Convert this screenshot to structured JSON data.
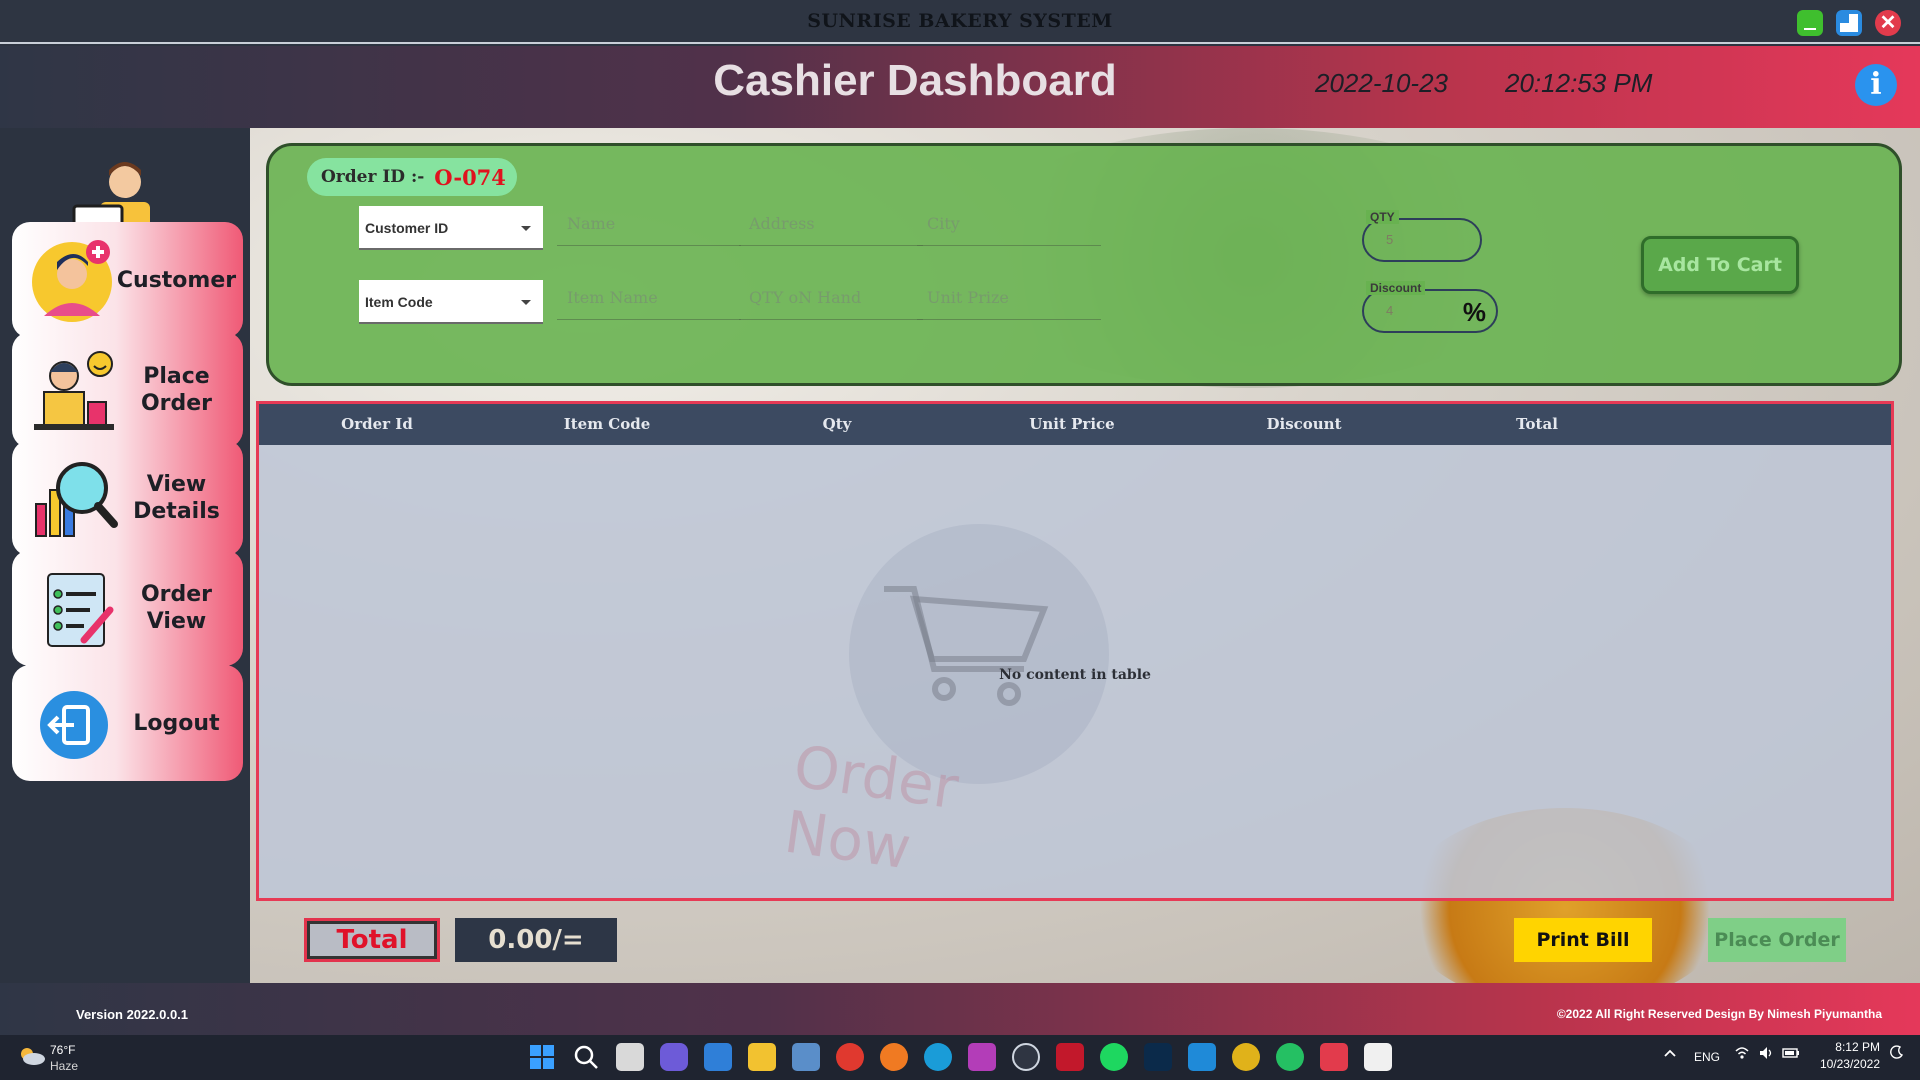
{
  "window": {
    "app_title": "SUNRISE BAKERY SYSTEM",
    "close_glyph": "✕"
  },
  "header": {
    "title": "Cashier Dashboard",
    "date": "2022-10-23",
    "time": "20:12:53 PM",
    "info_glyph": "i"
  },
  "sidebar": {
    "items": [
      {
        "label": "Customer",
        "icon": "customer-icon"
      },
      {
        "label": "Place\nOrder",
        "icon": "place-order-icon"
      },
      {
        "label": "View\nDetails",
        "icon": "view-details-icon"
      },
      {
        "label": "Order\nView",
        "icon": "order-view-icon"
      },
      {
        "label": "Logout",
        "icon": "logout-icon"
      }
    ]
  },
  "order_form": {
    "order_id_label": "Order ID :-",
    "order_id_value": "O-074",
    "customer_combo": "Customer ID",
    "item_combo": "Item Code",
    "name_placeholder": "Name",
    "address_placeholder": "Address",
    "city_placeholder": "City",
    "item_name_placeholder": "Item Name",
    "qty_on_hand_placeholder": "QTY oN Hand",
    "unit_prize_placeholder": "Unit Prize",
    "qty_label": "QTY",
    "qty_value": "5",
    "discount_label": "Discount",
    "discount_value": "4",
    "discount_suffix": "%",
    "add_to_cart": "Add To Cart"
  },
  "table": {
    "columns": [
      "Order Id",
      "Item Code",
      "Qty",
      "Unit Price",
      "Discount",
      "Total"
    ],
    "rows": [],
    "empty_message": "No content in table",
    "watermark_text": "Order\nNow"
  },
  "totals": {
    "total_label": "Total",
    "total_value": "0.00/=",
    "print_bill": "Print Bill",
    "place_order": "Place Order"
  },
  "footer": {
    "version": "Version 2022.0.0.1",
    "copyright": "©2022  All Right Reserved Design By Nimesh Piyumantha"
  },
  "taskbar": {
    "temperature": "76°F",
    "condition": "Haze",
    "language": "ENG",
    "clock_time": "8:12 PM",
    "clock_date": "10/23/2022"
  },
  "colors": {
    "accent_pink": "#e5385a",
    "panel_green": "#68b250",
    "table_header": "#3c4a61",
    "print_bill": "#ffd400"
  }
}
